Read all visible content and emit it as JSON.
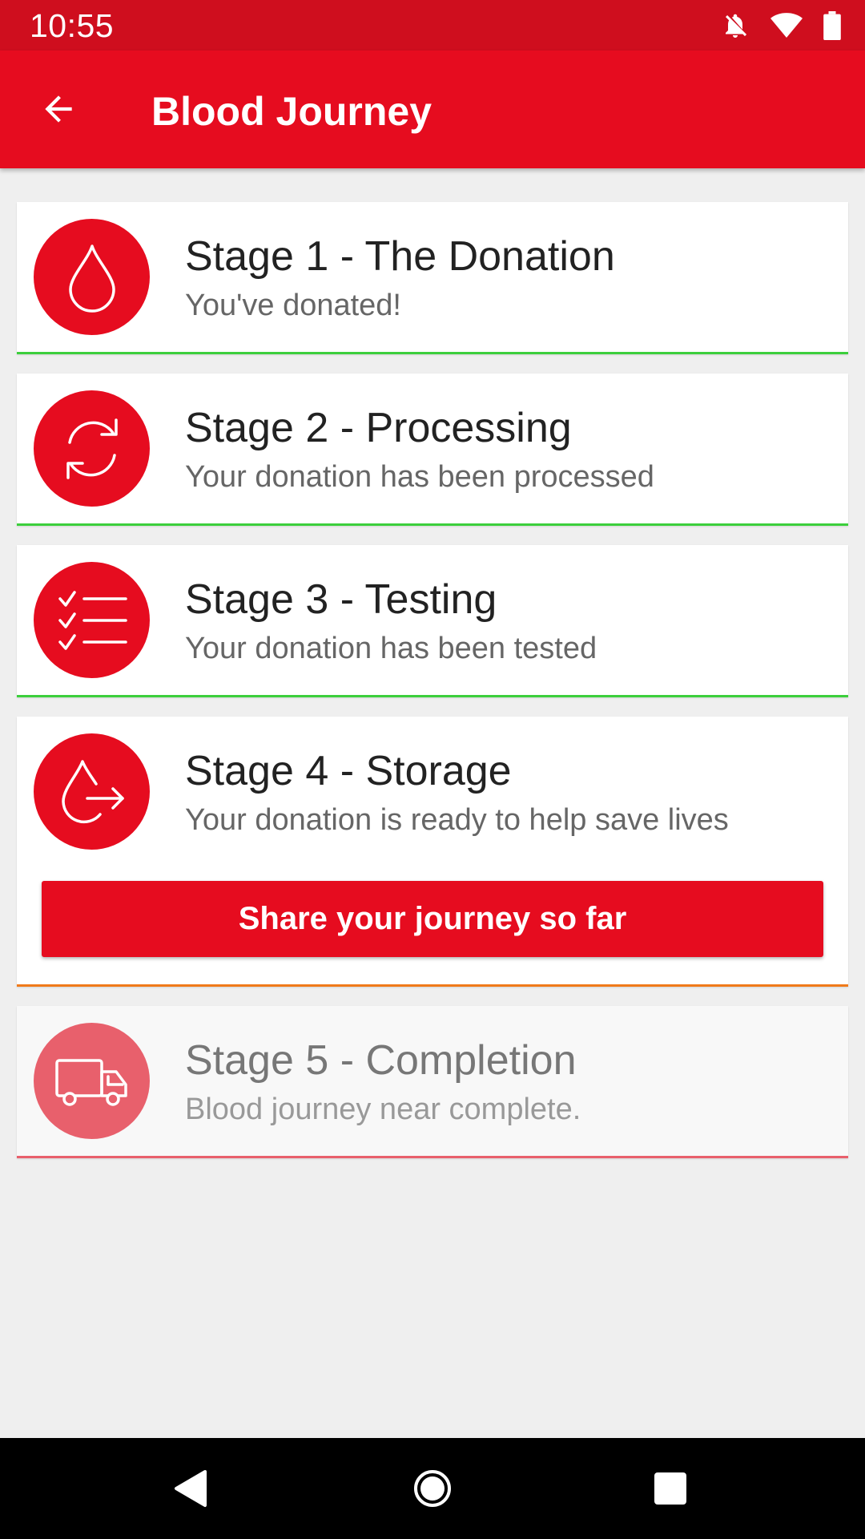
{
  "status_bar": {
    "time": "10:55",
    "icons": [
      "notifications-off-icon",
      "wifi-icon",
      "battery-icon"
    ]
  },
  "app_bar": {
    "title": "Blood Journey",
    "back_icon": "arrow-back-icon"
  },
  "colors": {
    "primary": "#e60c1f",
    "status_bar": "#cf0e1e",
    "complete": "#3ccf3c",
    "current": "#f07a1a",
    "pending": "#e8606c"
  },
  "stages": [
    {
      "title": "Stage 1 - The Donation",
      "subtitle": "You've donated!",
      "icon": "blood-drop-icon",
      "state": "complete"
    },
    {
      "title": "Stage 2 - Processing",
      "subtitle": "Your donation has been processed",
      "icon": "refresh-cycle-icon",
      "state": "complete"
    },
    {
      "title": "Stage 3 - Testing",
      "subtitle": "Your donation has been tested",
      "icon": "checklist-icon",
      "state": "complete"
    },
    {
      "title": "Stage 4 - Storage",
      "subtitle": "Your donation is ready to help save lives",
      "icon": "drop-arrow-icon",
      "state": "current"
    },
    {
      "title": "Stage 5 - Completion",
      "subtitle": "Blood journey near complete.",
      "icon": "truck-icon",
      "state": "pending"
    }
  ],
  "share_button": {
    "label": "Share your journey so far"
  },
  "nav_bar": {
    "buttons": [
      "back-triangle-icon",
      "home-circle-icon",
      "recents-square-icon"
    ]
  }
}
